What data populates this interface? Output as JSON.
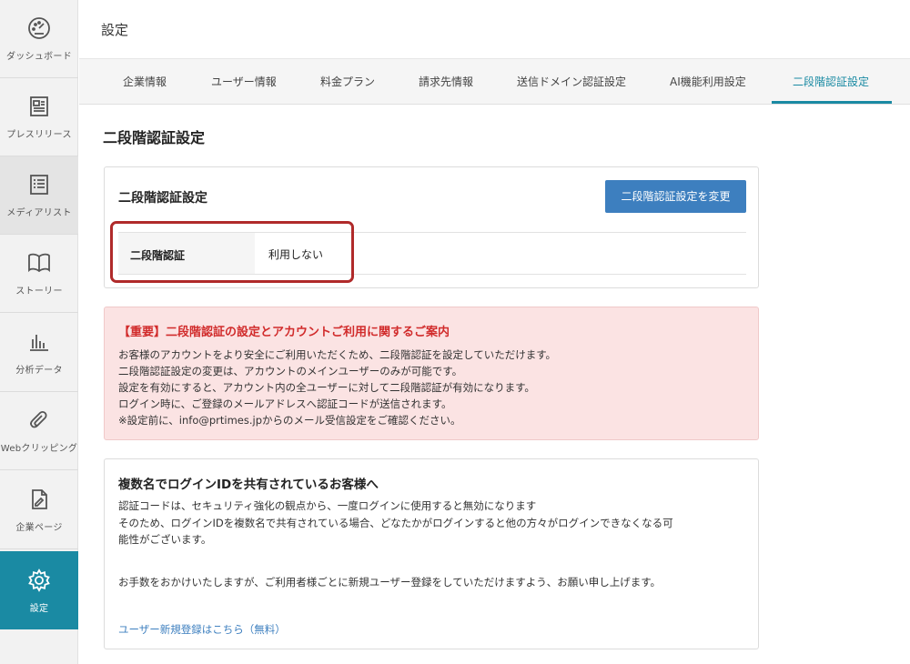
{
  "sidebar": {
    "items": [
      {
        "label": "ダッシュボード",
        "icon": "dashboard-icon"
      },
      {
        "label": "プレスリリース",
        "icon": "press-release-icon"
      },
      {
        "label": "メディアリスト",
        "icon": "media-list-icon"
      },
      {
        "label": "ストーリー",
        "icon": "book-icon"
      },
      {
        "label": "分析データ",
        "icon": "bar-chart-icon"
      },
      {
        "label": "Webクリッピング",
        "icon": "paperclip-icon"
      },
      {
        "label": "企業ページ",
        "icon": "company-page-icon"
      },
      {
        "label": "設定",
        "icon": "gear-icon",
        "active": true
      }
    ]
  },
  "header": {
    "title": "設定"
  },
  "tabs": [
    "企業情報",
    "ユーザー情報",
    "料金プラン",
    "請求先情報",
    "送信ドメイン認証設定",
    "AI機能利用設定",
    "二段階認証設定"
  ],
  "active_tab": "二段階認証設定",
  "main": {
    "section_title": "二段階認証設定",
    "card1": {
      "title": "二段階認証設定",
      "button": "二段階認証設定を変更",
      "row_label": "二段階認証",
      "row_value": "利用しない"
    },
    "alert": {
      "title": "【重要】二段階認証の設定とアカウントご利用に関するご案内",
      "lines": [
        "お客様のアカウントをより安全にご利用いただくため、二段階認証を設定していただけます。",
        "二段階認証設定の変更は、アカウントのメインユーザーのみが可能です。",
        "設定を有効にすると、アカウント内の全ユーザーに対して二段階認証が有効になります。",
        "ログイン時に、ご登録のメールアドレスへ認証コードが送信されます。",
        "※設定前に、info@prtimes.jpからのメール受信設定をご確認ください。"
      ]
    },
    "card3": {
      "title": "複数名でログインIDを共有されているお客様へ",
      "lines": [
        "認証コードは、セキュリティ強化の観点から、一度ログインに使用すると無効になります",
        "そのため、ログインIDを複数名で共有されている場合、どなたかがログインすると他の方々がログインできなくなる可",
        "能性がございます。",
        "お手数をおかけいたしますが、ご利用者様ごとに新規ユーザー登録をしていただけますよう、お願い申し上げます。"
      ],
      "link": "ユーザー新規登録はこちら（無料）"
    }
  },
  "colors": {
    "accent": "#1a8aa3",
    "button": "#3d7fbf",
    "alert_bg": "#fbe3e3",
    "alert_title": "#d12b2b",
    "highlight": "#b02a2a"
  }
}
